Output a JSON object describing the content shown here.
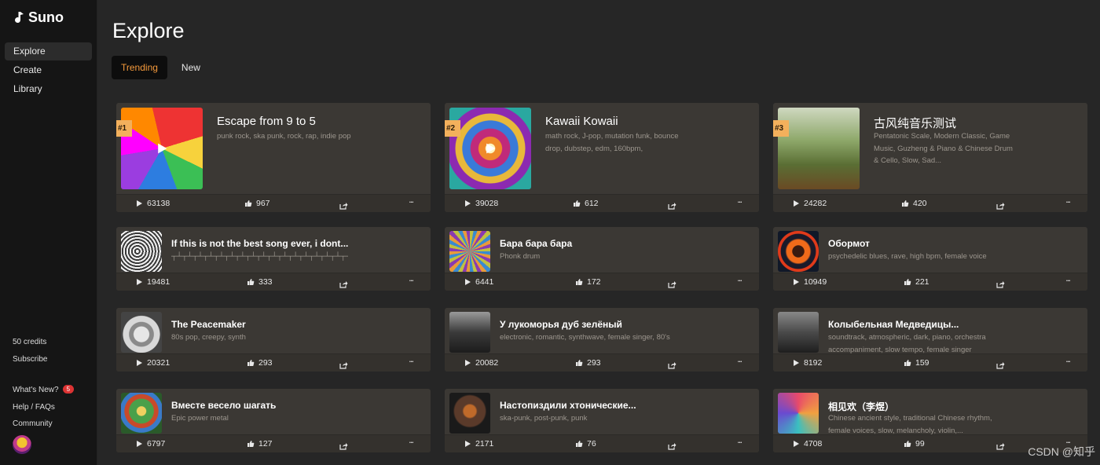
{
  "app": {
    "name": "Suno"
  },
  "sidebar": {
    "nav": [
      {
        "label": "Explore",
        "active": true
      },
      {
        "label": "Create",
        "active": false
      },
      {
        "label": "Library",
        "active": false
      }
    ],
    "credits": "50 credits",
    "subscribe": "Subscribe",
    "whats_new": "What's New?",
    "whats_new_badge": "5",
    "help": "Help / FAQs",
    "community": "Community"
  },
  "page": {
    "title": "Explore"
  },
  "tabs": [
    {
      "label": "Trending",
      "active": true
    },
    {
      "label": "New",
      "active": false
    }
  ],
  "featured": [
    {
      "rank": "#1",
      "title": "Escape from 9 to 5",
      "tags": "punk rock, ska punk, rock, rap, indie pop",
      "plays": "63138",
      "likes": "967",
      "thumb_icon": "rainbow-chains-art"
    },
    {
      "rank": "#2",
      "title": "Kawaii Kowaii",
      "tags": "math rock, J-pop, mutation funk, bounce drop, dubstep, edm, 160bpm,",
      "plays": "39028",
      "likes": "612",
      "thumb_icon": "kaleidoscope-art"
    },
    {
      "rank": "#3",
      "title": "古风纯音乐测试",
      "tags": "Pentatonic Scale, Modern Classic, Game Music, Guzheng & Piano & Chinese Drum & Cello, Slow, Sad...",
      "plays": "24282",
      "likes": "420",
      "thumb_icon": "tree-cello-art"
    }
  ],
  "songs": [
    {
      "title": "If this is not the best song ever, i dont...",
      "tags": "┬┴┬┴┬┴┬┴┬┴┬┴┬┴┬┴┬┴┬┴┬┴┬┴┬┴┬┴┬┴┬┴┬┴┬┴┬┴┬┴┬┴┬┴┬┴┬┴┬┴┬┴┬┴┬┴┬┴┬┴┬┴┬┴┬┴┬┴┬┴┬┴┬┴┬┴",
      "plays": "19481",
      "likes": "333",
      "thumb_icon": "tree-rings-art"
    },
    {
      "title": "Бара бара бара",
      "tags": "Phonk drum",
      "plays": "6441",
      "likes": "172",
      "thumb_icon": "psychedelic-pattern-art"
    },
    {
      "title": "Обормот",
      "tags": "psychedelic blues, rave, high bpm, female voice",
      "plays": "10949",
      "likes": "221",
      "thumb_icon": "fire-portal-art"
    },
    {
      "title": "The Peacemaker",
      "tags": "80s pop, creepy, synth",
      "plays": "20321",
      "likes": "293",
      "thumb_icon": "bird-sketch-art"
    },
    {
      "title": "У лукоморья дуб зелёный",
      "tags": "electronic, romantic, synthwave, female singer, 80's",
      "plays": "20082",
      "likes": "293",
      "thumb_icon": "forest-path-art"
    },
    {
      "title": "Колыбельная Медведицы...",
      "tags": "soundtrack, atmospheric, dark, piano, orchestra accompaniment, slow tempo, female singer",
      "plays": "8192",
      "likes": "159",
      "thumb_icon": "piano-forest-art"
    },
    {
      "title": "Вместе весело шагать",
      "tags": "Epic power metal",
      "plays": "6797",
      "likes": "127",
      "thumb_icon": "rainbow-landscape-art"
    },
    {
      "title": "Настопиздили хтонические...",
      "tags": "ska-punk, post-punk, punk",
      "plays": "2171",
      "likes": "76",
      "thumb_icon": "dark-creature-art"
    },
    {
      "title": "相见欢（李煜）",
      "tags": "Chinese ancient style, traditional Chinese rhythm, female voices, slow, melancholy, violin,...",
      "plays": "4708",
      "likes": "99",
      "thumb_icon": "colorful-splash-art"
    }
  ],
  "watermark": "CSDN @知乎"
}
